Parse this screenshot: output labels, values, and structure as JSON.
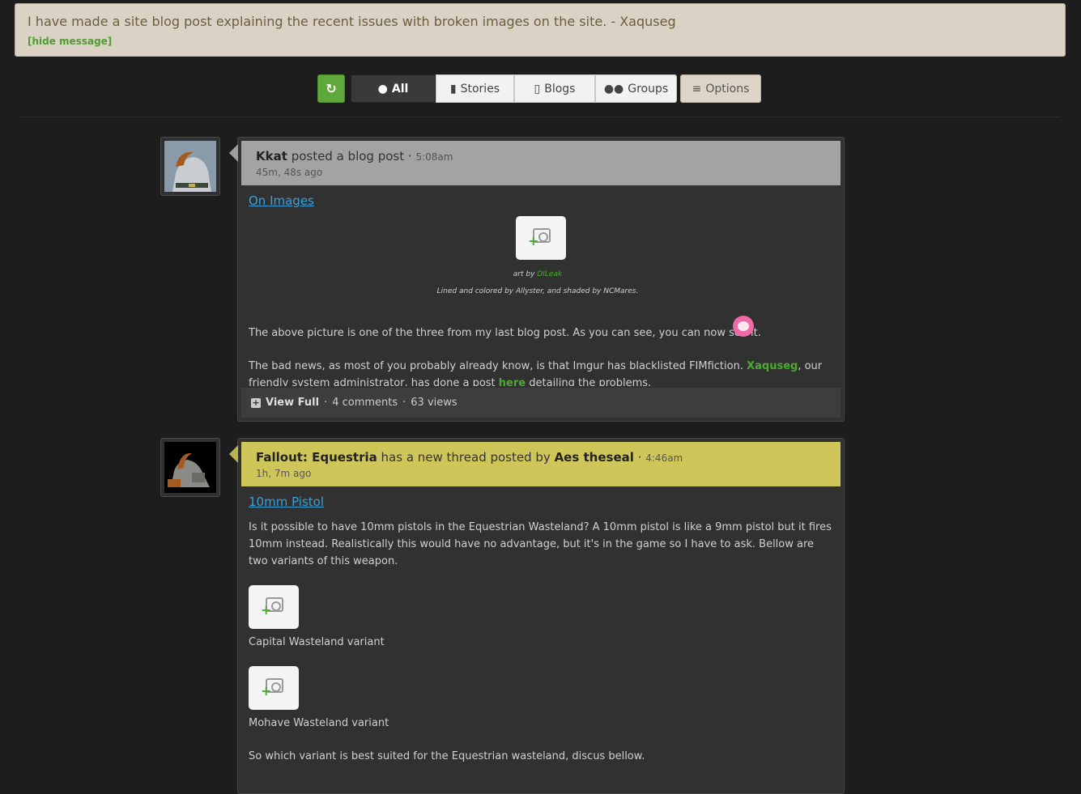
{
  "notice": {
    "message": "I have made a site blog post explaining the recent issues with broken images on the site. - Xaquseg",
    "hide_label": "[hide message]"
  },
  "toolbar": {
    "refresh_icon": "refresh-icon",
    "tabs": [
      {
        "label": "All",
        "icon": "globe-icon",
        "active": true
      },
      {
        "label": "Stories",
        "icon": "book-icon",
        "active": false
      },
      {
        "label": "Blogs",
        "icon": "document-icon",
        "active": false
      },
      {
        "label": "Groups",
        "icon": "users-icon",
        "active": false
      }
    ],
    "options_label": "Options",
    "options_icon": "menu-icon"
  },
  "feed": [
    {
      "author": "Kkat",
      "action": "posted a blog post",
      "sep": "·",
      "time": "5:08am",
      "ago": "45m, 48s ago",
      "title": "On Images",
      "art_by_prefix": "art by",
      "art_by_name": "DILeak",
      "art_credit": "Lined and colored by Allyster, and shaded by NCMares.",
      "p1": "The above picture is one of the three from my last blog post.  As you can see, you can now see it.",
      "p2_a": "The bad news, as most of you probably already know, is that Imgur has blacklisted FIMfiction.",
      "p2_link": "Xaquseg",
      "p2_b": ", our friendly",
      "p2_c": "system administrator, has done a post",
      "p2_here": "here",
      "p2_d": "detailing the problems.",
      "footer": {
        "view_full": "View Full",
        "comments": "4 comments",
        "views": "63 views"
      }
    },
    {
      "group": "Fallout: Equestria",
      "action": "has a new thread posted by",
      "author": "Aes theseal",
      "sep": "·",
      "time": "4:46am",
      "ago": "1h, 7m ago",
      "title": "10mm Pistol",
      "p1": "Is it possible to have 10mm pistols in the Equestrian Wasteland? A 10mm pistol is like a 9mm pistol but it fires 10mm instead. Realistically this would have no advantage, but it's in the game so I have to ask. Bellow are two variants of this weapon.",
      "caption1": "Capital Wasteland variant",
      "caption2": "Mohave Wasteland variant",
      "p2": "So which variant is best suited for the Equestrian wasteland, discus bellow."
    }
  ],
  "colors": {
    "background": "#1d1d1d",
    "accent_green": "#5fa83a",
    "blog_header": "#a3a3a3",
    "group_header": "#cfc65a",
    "link_blue": "#3aa0d8"
  }
}
